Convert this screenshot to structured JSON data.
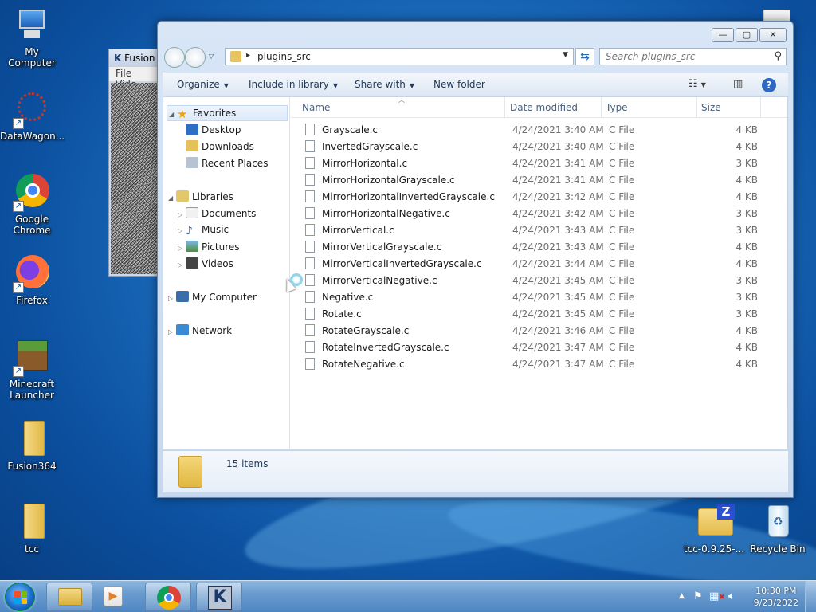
{
  "desktop": {
    "icons": [
      {
        "label": "My Computer"
      },
      {
        "label": "DataWagon..."
      },
      {
        "label": "Google Chrome"
      },
      {
        "label": "Firefox"
      },
      {
        "label": "Minecraft Launcher"
      },
      {
        "label": "Fusion364"
      },
      {
        "label": "tcc"
      },
      {
        "label": "tcc-0.9.25-..."
      },
      {
        "label": "Recycle Bin"
      }
    ]
  },
  "background_window": {
    "title": "Fusion",
    "menu": [
      "File",
      "Vide"
    ]
  },
  "explorer": {
    "controls": {
      "minimize": "—",
      "maximize": "▢",
      "close": "✕"
    },
    "address": {
      "path": "plugins_src"
    },
    "search": {
      "placeholder": "Search plugins_src"
    },
    "toolbar": {
      "organize": "Organize",
      "include_in_library": "Include in library",
      "share_with": "Share with",
      "new_folder": "New folder"
    },
    "nav": {
      "favorites": "Favorites",
      "desktop": "Desktop",
      "downloads": "Downloads",
      "recent_places": "Recent Places",
      "libraries": "Libraries",
      "documents": "Documents",
      "music": "Music",
      "pictures": "Pictures",
      "videos": "Videos",
      "my_computer": "My Computer",
      "network": "Network"
    },
    "columns": {
      "name": "Name",
      "date": "Date modified",
      "type": "Type",
      "size": "Size"
    },
    "files": [
      {
        "name": "Grayscale.c",
        "date": "4/24/2021 3:40 AM",
        "type": "C File",
        "size": "4 KB"
      },
      {
        "name": "InvertedGrayscale.c",
        "date": "4/24/2021 3:40 AM",
        "type": "C File",
        "size": "4 KB"
      },
      {
        "name": "MirrorHorizontal.c",
        "date": "4/24/2021 3:41 AM",
        "type": "C File",
        "size": "3 KB"
      },
      {
        "name": "MirrorHorizontalGrayscale.c",
        "date": "4/24/2021 3:41 AM",
        "type": "C File",
        "size": "4 KB"
      },
      {
        "name": "MirrorHorizontalInvertedGrayscale.c",
        "date": "4/24/2021 3:42 AM",
        "type": "C File",
        "size": "4 KB"
      },
      {
        "name": "MirrorHorizontalNegative.c",
        "date": "4/24/2021 3:42 AM",
        "type": "C File",
        "size": "3 KB"
      },
      {
        "name": "MirrorVertical.c",
        "date": "4/24/2021 3:43 AM",
        "type": "C File",
        "size": "3 KB"
      },
      {
        "name": "MirrorVerticalGrayscale.c",
        "date": "4/24/2021 3:43 AM",
        "type": "C File",
        "size": "4 KB"
      },
      {
        "name": "MirrorVerticalInvertedGrayscale.c",
        "date": "4/24/2021 3:44 AM",
        "type": "C File",
        "size": "4 KB"
      },
      {
        "name": "MirrorVerticalNegative.c",
        "date": "4/24/2021 3:45 AM",
        "type": "C File",
        "size": "3 KB"
      },
      {
        "name": "Negative.c",
        "date": "4/24/2021 3:45 AM",
        "type": "C File",
        "size": "3 KB"
      },
      {
        "name": "Rotate.c",
        "date": "4/24/2021 3:45 AM",
        "type": "C File",
        "size": "3 KB"
      },
      {
        "name": "RotateGrayscale.c",
        "date": "4/24/2021 3:46 AM",
        "type": "C File",
        "size": "4 KB"
      },
      {
        "name": "RotateInvertedGrayscale.c",
        "date": "4/24/2021 3:47 AM",
        "type": "C File",
        "size": "4 KB"
      },
      {
        "name": "RotateNegative.c",
        "date": "4/24/2021 3:47 AM",
        "type": "C File",
        "size": "4 KB"
      }
    ],
    "details": {
      "count": "15 items"
    }
  },
  "taskbar": {
    "clock": {
      "time": "10:30 PM",
      "date": "9/23/2022"
    }
  },
  "colors": {
    "accent": "#1e6fc0",
    "link_text": "#1e395b"
  }
}
